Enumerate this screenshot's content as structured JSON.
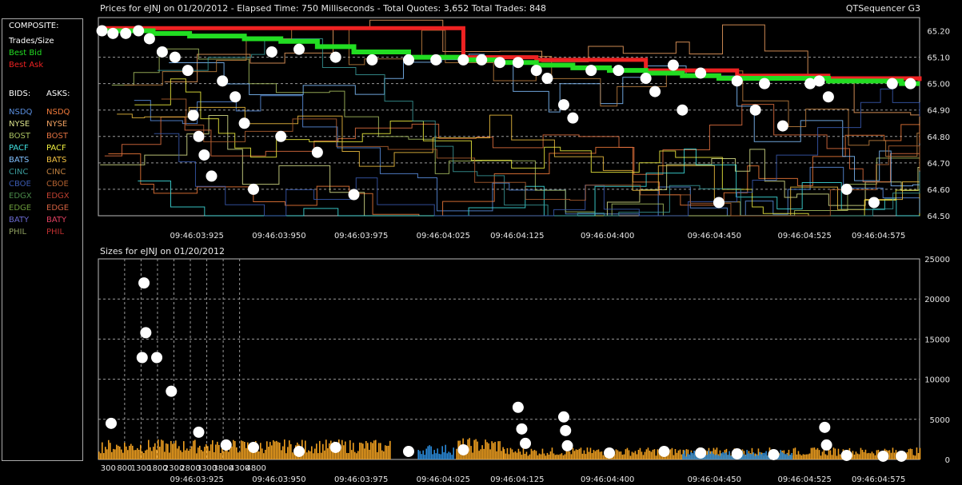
{
  "header": {
    "prices_title": "Prices for  eJNJ  on  01/20/2012  -  Elapsed Time: 750 Milliseconds  -  Total Quotes: 3,652  Total Trades: 848",
    "app_name": "QTSequencer G3",
    "sizes_title": "Sizes for  eJNJ  on  01/20/2012"
  },
  "legend": {
    "composite_heading": "COMPOSITE:",
    "composite": [
      {
        "label": "Trades/Size",
        "color": "#ffffff"
      },
      {
        "label": "Best Bid",
        "color": "#22dd22"
      },
      {
        "label": "Best Ask",
        "color": "#ee2222"
      }
    ],
    "bids_heading": "BIDS:",
    "asks_heading": "ASKS:",
    "exchanges": [
      {
        "bid": "NSDQ",
        "ask": "NSDQ",
        "bid_color": "#5a8fe0",
        "ask_color": "#f07a3a"
      },
      {
        "bid": "NYSE",
        "ask": "NYSE",
        "bid_color": "#d8e08a",
        "ask_color": "#f0a060"
      },
      {
        "bid": "BOST",
        "ask": "BOST",
        "bid_color": "#a8c060",
        "ask_color": "#e07040"
      },
      {
        "bid": "PACF",
        "ask": "PACF",
        "bid_color": "#40e0e0",
        "ask_color": "#f0f040"
      },
      {
        "bid": "BATS",
        "ask": "BATS",
        "bid_color": "#80c0ff",
        "ask_color": "#f0c040"
      },
      {
        "bid": "CINC",
        "ask": "CINC",
        "bid_color": "#3a9a9a",
        "ask_color": "#c08040"
      },
      {
        "bid": "CBOE",
        "ask": "CBOE",
        "bid_color": "#3a5ab0",
        "ask_color": "#b06030"
      },
      {
        "bid": "EDGX",
        "ask": "EDGX",
        "bid_color": "#4a8a4a",
        "ask_color": "#c04030"
      },
      {
        "bid": "EDGE",
        "ask": "EDGE",
        "bid_color": "#6a9a3a",
        "ask_color": "#d06040"
      },
      {
        "bid": "BATY",
        "ask": "BATY",
        "bid_color": "#6a6ad0",
        "ask_color": "#e04060"
      },
      {
        "bid": "PHIL",
        "ask": "PHIL",
        "bid_color": "#90a060",
        "ask_color": "#c03030"
      }
    ]
  },
  "chart_data": [
    {
      "type": "line",
      "title": "Prices for  eJNJ  on  01/20/2012",
      "xlim": [
        300,
        4800
      ],
      "ylim": [
        64.5,
        65.25
      ],
      "x_ticks": [
        "300",
        "800",
        "1300",
        "1800",
        "2300",
        "2800",
        "3300",
        "3800",
        "4300",
        "4800"
      ],
      "y_ticks": [
        "65.20",
        "65.10",
        "65.00",
        "64.90",
        "64.80",
        "64.70",
        "64.60",
        "64.50"
      ],
      "time_labels": [
        "09:46:03:925",
        "09:46:03:950",
        "09:46:03:975",
        "09:46:04:025",
        "09:46:04:125",
        "09:46:04:400",
        "09:46:04:450",
        "09:46:04:525",
        "09:46:04:575"
      ],
      "series": [
        {
          "name": "Best Bid",
          "x": [
            300,
            600,
            800,
            1100,
            1300,
            1500,
            1700,
            2000,
            2300,
            2500,
            2700,
            2900,
            3100,
            3300,
            3500,
            3700,
            3900,
            4100,
            4300,
            4500,
            4700,
            4800
          ],
          "values": [
            65.2,
            65.19,
            65.18,
            65.17,
            65.16,
            65.14,
            65.12,
            65.1,
            65.09,
            65.08,
            65.07,
            65.06,
            65.05,
            65.04,
            65.03,
            65.02,
            65.02,
            65.02,
            65.01,
            65.01,
            65.0,
            65.0
          ]
        },
        {
          "name": "Best Ask",
          "x": [
            300,
            1600,
            2300,
            2700,
            3300,
            3800,
            4300,
            4800
          ],
          "values": [
            65.21,
            65.21,
            65.1,
            65.09,
            65.05,
            65.03,
            65.02,
            65.01
          ]
        },
        {
          "name": "Trades/Size",
          "x": [
            320,
            380,
            450,
            520,
            580,
            650,
            720,
            790,
            820,
            850,
            880,
            920,
            980,
            1050,
            1100,
            1150,
            1250,
            1300,
            1400,
            1500,
            1600,
            1700,
            1800,
            2000,
            2150,
            2300,
            2400,
            2500,
            2600,
            2700,
            2760,
            2850,
            2900,
            3000,
            3150,
            3300,
            3350,
            3450,
            3500,
            3600,
            3700,
            3800,
            3900,
            3950,
            4050,
            4200,
            4250,
            4300,
            4400,
            4550,
            4650,
            4750
          ],
          "values": [
            65.2,
            65.19,
            65.19,
            65.2,
            65.17,
            65.12,
            65.1,
            65.05,
            64.88,
            64.8,
            64.73,
            64.65,
            65.01,
            64.95,
            64.85,
            64.6,
            65.12,
            64.8,
            65.13,
            64.74,
            65.1,
            64.58,
            65.09,
            65.09,
            65.09,
            65.09,
            65.09,
            65.08,
            65.08,
            65.05,
            65.02,
            64.92,
            64.87,
            65.05,
            65.05,
            65.02,
            64.97,
            65.07,
            64.9,
            65.04,
            64.55,
            65.01,
            64.9,
            65.0,
            64.84,
            65.0,
            65.01,
            64.95,
            64.6,
            64.55,
            65.0,
            65.0
          ]
        }
      ]
    },
    {
      "type": "bar",
      "title": "Sizes for  eJNJ  on  01/20/2012",
      "xlim": [
        300,
        4800
      ],
      "ylim": [
        0,
        25000
      ],
      "x_ticks": [
        "300",
        "800",
        "1300",
        "1800",
        "2300",
        "2800",
        "3300",
        "3800",
        "4300",
        "4800"
      ],
      "y_ticks": [
        "25000",
        "20000",
        "15000",
        "10000",
        "5000",
        "0"
      ],
      "trades": [
        {
          "x": 370,
          "y": 4500
        },
        {
          "x": 550,
          "y": 22000
        },
        {
          "x": 560,
          "y": 15800
        },
        {
          "x": 540,
          "y": 12700
        },
        {
          "x": 620,
          "y": 12700
        },
        {
          "x": 700,
          "y": 8500
        },
        {
          "x": 850,
          "y": 3400
        },
        {
          "x": 1000,
          "y": 1800
        },
        {
          "x": 1150,
          "y": 1500
        },
        {
          "x": 1400,
          "y": 1000
        },
        {
          "x": 1600,
          "y": 1500
        },
        {
          "x": 2000,
          "y": 1000
        },
        {
          "x": 2300,
          "y": 1200
        },
        {
          "x": 2600,
          "y": 6500
        },
        {
          "x": 2620,
          "y": 3800
        },
        {
          "x": 2640,
          "y": 2000
        },
        {
          "x": 2850,
          "y": 5300
        },
        {
          "x": 2860,
          "y": 3600
        },
        {
          "x": 2870,
          "y": 1700
        },
        {
          "x": 3100,
          "y": 800
        },
        {
          "x": 3400,
          "y": 1000
        },
        {
          "x": 3600,
          "y": 800
        },
        {
          "x": 3800,
          "y": 700
        },
        {
          "x": 4000,
          "y": 600
        },
        {
          "x": 4280,
          "y": 4000
        },
        {
          "x": 4290,
          "y": 1800
        },
        {
          "x": 4400,
          "y": 500
        },
        {
          "x": 4600,
          "y": 400
        },
        {
          "x": 4700,
          "y": 400
        }
      ],
      "quote_bands": [
        {
          "x0": 300,
          "x1": 1900,
          "level": 2500,
          "color": "#f0a020"
        },
        {
          "x0": 2050,
          "x1": 2250,
          "level": 1900,
          "color": "#2a8ad8"
        },
        {
          "x0": 2260,
          "x1": 2520,
          "level": 2700,
          "color": "#f0a020"
        },
        {
          "x0": 2520,
          "x1": 4800,
          "level": 1500,
          "color": "#f0a020"
        },
        {
          "x0": 3500,
          "x1": 4100,
          "level": 1200,
          "color": "#2a8ad8"
        }
      ]
    }
  ]
}
